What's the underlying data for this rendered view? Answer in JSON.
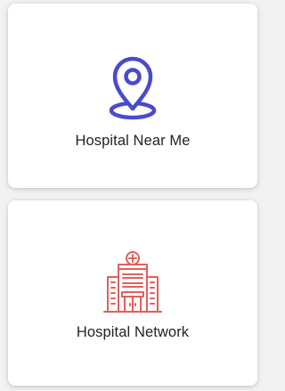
{
  "cards": [
    {
      "label": "Hospital Near Me",
      "icon": "location-pin-icon",
      "color": "#4a4ad0"
    },
    {
      "label": "Hospital Network",
      "icon": "hospital-building-icon",
      "color": "#e0605a"
    }
  ],
  "colors": {
    "background": "#f2f2f2",
    "card": "#ffffff",
    "text": "#222222"
  }
}
